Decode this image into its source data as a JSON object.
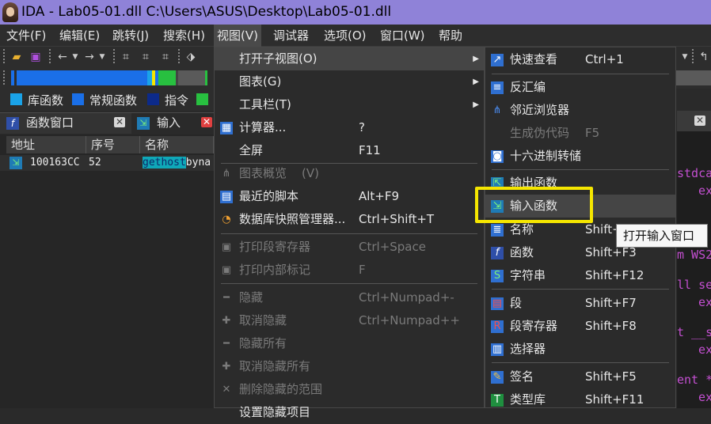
{
  "window": {
    "title": "IDA - Lab05-01.dll C:\\Users\\ASUS\\Desktop\\Lab05-01.dll"
  },
  "menubar": [
    {
      "label": "文件(F)"
    },
    {
      "label": "编辑(E)"
    },
    {
      "label": "跳转(J)"
    },
    {
      "label": "搜索(H)"
    },
    {
      "label": "视图(V)"
    },
    {
      "label": "调试器"
    },
    {
      "label": "选项(O)"
    },
    {
      "label": "窗口(W)"
    },
    {
      "label": "帮助"
    }
  ],
  "legend": [
    {
      "label": "库函数",
      "color": "#1aa3e8"
    },
    {
      "label": "常规函数",
      "color": "#1a6fe8"
    },
    {
      "label": "指令",
      "color": "#0c2a8a"
    },
    {
      "label": "",
      "color": "#28c040"
    }
  ],
  "tabs": [
    {
      "label": "函数窗口",
      "icon": "function-icon"
    },
    {
      "label": "输入",
      "icon": "imports-icon"
    }
  ],
  "table": {
    "headers": [
      "地址",
      "序号",
      "名称"
    ],
    "row": {
      "address": "100163CC",
      "ordinal": "52",
      "name_highlight": "gethost",
      "name_rest": "byna"
    }
  },
  "view_menu": [
    {
      "label": "打开子视图(O)",
      "shortcut": "",
      "submenu": true,
      "icon": ""
    },
    {
      "label": "图表(G)",
      "shortcut": "",
      "submenu": true,
      "icon": ""
    },
    {
      "label": "工具栏(T)",
      "shortcut": "",
      "submenu": true,
      "icon": ""
    },
    {
      "label": "计算器...",
      "shortcut": "?",
      "icon": "calculator-icon"
    },
    {
      "label": "全屏",
      "shortcut": "F11",
      "icon": ""
    },
    {
      "label": "图表概览",
      "shortcut": "(V)",
      "disabled": true,
      "icon": "graph-overview-icon"
    },
    {
      "label": "最近的脚本",
      "shortcut": "Alt+F9",
      "icon": "script-icon"
    },
    {
      "label": "数据库快照管理器...",
      "shortcut": "Ctrl+Shift+T",
      "icon": "snapshot-icon"
    },
    {
      "label": "打印段寄存器",
      "shortcut": "Ctrl+Space",
      "disabled": true,
      "icon": "print-icon"
    },
    {
      "label": "打印内部标记",
      "shortcut": "F",
      "disabled": true,
      "icon": "print-icon"
    },
    {
      "label": "隐藏",
      "shortcut": "Ctrl+Numpad+-",
      "disabled": true,
      "icon": "minus-icon"
    },
    {
      "label": "取消隐藏",
      "shortcut": "Ctrl+Numpad++",
      "disabled": true,
      "icon": "plus-icon"
    },
    {
      "label": "隐藏所有",
      "shortcut": "",
      "disabled": true,
      "icon": "minus-icon"
    },
    {
      "label": "取消隐藏所有",
      "shortcut": "",
      "disabled": true,
      "icon": "plus-icon"
    },
    {
      "label": "删除隐藏的范围",
      "shortcut": "",
      "disabled": true,
      "icon": "close-icon"
    },
    {
      "label": "设置隐藏项目",
      "shortcut": "",
      "disabled": false,
      "icon": ""
    }
  ],
  "subviews_menu": [
    {
      "label": "快速查看",
      "shortcut": "Ctrl+1",
      "icon": "quick-view-icon"
    },
    {
      "label": "反汇编",
      "shortcut": "",
      "icon": "disassembly-icon"
    },
    {
      "label": "邻近浏览器",
      "shortcut": "",
      "icon": "proximity-browser-icon"
    },
    {
      "label": "生成伪代码",
      "shortcut": "F5",
      "disabled": true,
      "icon": ""
    },
    {
      "label": "十六进制转储",
      "shortcut": "",
      "icon": "hex-dump-icon"
    },
    {
      "label": "输出函数",
      "shortcut": "",
      "icon": "exports-icon"
    },
    {
      "label": "输入函数",
      "shortcut": "",
      "icon": "imports-icon",
      "highlighted": true
    },
    {
      "label": "名称",
      "shortcut": "Shift+",
      "icon": "names-icon"
    },
    {
      "label": "函数",
      "shortcut": "Shift+F3",
      "icon": "functions-icon"
    },
    {
      "label": "字符串",
      "shortcut": "Shift+F12",
      "icon": "strings-icon"
    },
    {
      "label": "段",
      "shortcut": "Shift+F7",
      "icon": "segments-icon"
    },
    {
      "label": "段寄存器",
      "shortcut": "Shift+F8",
      "icon": "segment-registers-icon"
    },
    {
      "label": "选择器",
      "shortcut": "",
      "icon": "selectors-icon"
    },
    {
      "label": "签名",
      "shortcut": "Shift+F5",
      "icon": "signatures-icon"
    },
    {
      "label": "类型库",
      "shortcut": "Shift+F11",
      "icon": "type-libraries-icon"
    }
  ],
  "tooltip": "打开输入窗口",
  "code_fragments": [
    "stdca",
    "ex",
    "m WS2",
    "ll se",
    "ex",
    "t __s",
    "ex",
    "ent *",
    "ex"
  ]
}
